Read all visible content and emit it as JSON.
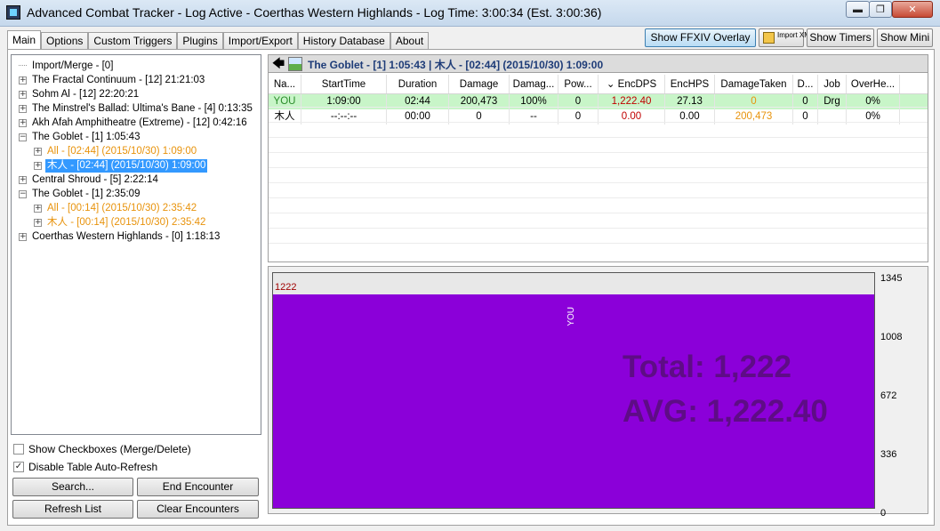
{
  "window": {
    "title": "Advanced Combat Tracker - Log Active - Coerthas Western Highlands - Log Time: 3:00:34 (Est. 3:00:36)",
    "min_glyph": "▬",
    "max_glyph": "❐",
    "close_glyph": "✕"
  },
  "tabs": [
    "Main",
    "Options",
    "Custom Triggers",
    "Plugins",
    "Import/Export",
    "History Database",
    "About"
  ],
  "toolbar": {
    "ffxiv_overlay": "Show FFXIV Overlay",
    "import_xml": "Import XML",
    "show_timers": "Show Timers",
    "show_mini": "Show Mini"
  },
  "tree": [
    {
      "label": "Import/Merge - [0]",
      "expander": "",
      "color": "",
      "selected": false
    },
    {
      "label": "The Fractal Continuum - [12] 21:21:03",
      "expander": "+"
    },
    {
      "label": "Sohm Al - [12] 22:20:21",
      "expander": "+"
    },
    {
      "label": "The Minstrel's Ballad: Ultima's Bane - [4] 0:13:35",
      "expander": "+"
    },
    {
      "label": "Akh Afah Amphitheatre (Extreme) - [12] 0:42:16",
      "expander": "+"
    },
    {
      "label": "The Goblet - [1] 1:05:43",
      "expander": "−"
    },
    {
      "label": "All - [02:44] (2015/10/30) 1:09:00",
      "expander": "+",
      "color": "orange"
    },
    {
      "label": "木人 - [02:44] (2015/10/30) 1:09:00",
      "expander": "+",
      "selected": true
    },
    {
      "label": "Central Shroud - [5] 2:22:14",
      "expander": "+"
    },
    {
      "label": "The Goblet - [1] 2:35:09",
      "expander": "−"
    },
    {
      "label": "All - [00:14] (2015/10/30) 2:35:42",
      "expander": "+",
      "color": "orange"
    },
    {
      "label": "木人 - [00:14] (2015/10/30) 2:35:42",
      "expander": "+",
      "color": "orange"
    },
    {
      "label": "Coerthas Western Highlands - [0] 1:18:13",
      "expander": "+"
    }
  ],
  "options": {
    "show_checkboxes": "Show Checkboxes (Merge/Delete)",
    "show_checkboxes_checked": false,
    "disable_refresh": "Disable Table Auto-Refresh",
    "disable_refresh_checked": true
  },
  "buttons": {
    "search": "Search...",
    "end_encounter": "End Encounter",
    "refresh_list": "Refresh List",
    "clear_encounters": "Clear Encounters"
  },
  "encounter": {
    "title": "The Goblet - [1] 1:05:43 | 木人 - [02:44] (2015/10/30) 1:09:00",
    "columns": [
      "Na...",
      "StartTime",
      "Duration",
      "Damage",
      "Damag...",
      "Pow...",
      "⌄ EncDPS",
      "EncHPS",
      "DamageTaken",
      "D...",
      "Job",
      "OverHe..."
    ],
    "rows": [
      [
        "YOU",
        "1:09:00",
        "02:44",
        "200,473",
        "100%",
        "0",
        "1,222.40",
        "27.13",
        "0",
        "0",
        "Drg",
        "0%"
      ],
      [
        "木人",
        "--:--:--",
        "00:00",
        "0",
        "--",
        "0",
        "0.00",
        "0.00",
        "200,473",
        "0",
        "",
        "0%"
      ]
    ]
  },
  "graph": {
    "top_value_label": "1222",
    "bar_name": "YOU",
    "total_text": "Total: 1,222",
    "avg_text": "AVG: 1,222.40",
    "y_ticks": [
      "1345",
      "1008",
      "672",
      "336",
      "0"
    ],
    "bar_color": "#8b00d9"
  },
  "chart_data": {
    "type": "bar",
    "categories": [
      "YOU"
    ],
    "values": [
      1222
    ],
    "ylim": [
      0,
      1345
    ],
    "yticks": [
      0,
      336,
      672,
      1008,
      1345
    ],
    "annotations": [
      "Total: 1,222",
      "AVG: 1,222.40"
    ]
  }
}
